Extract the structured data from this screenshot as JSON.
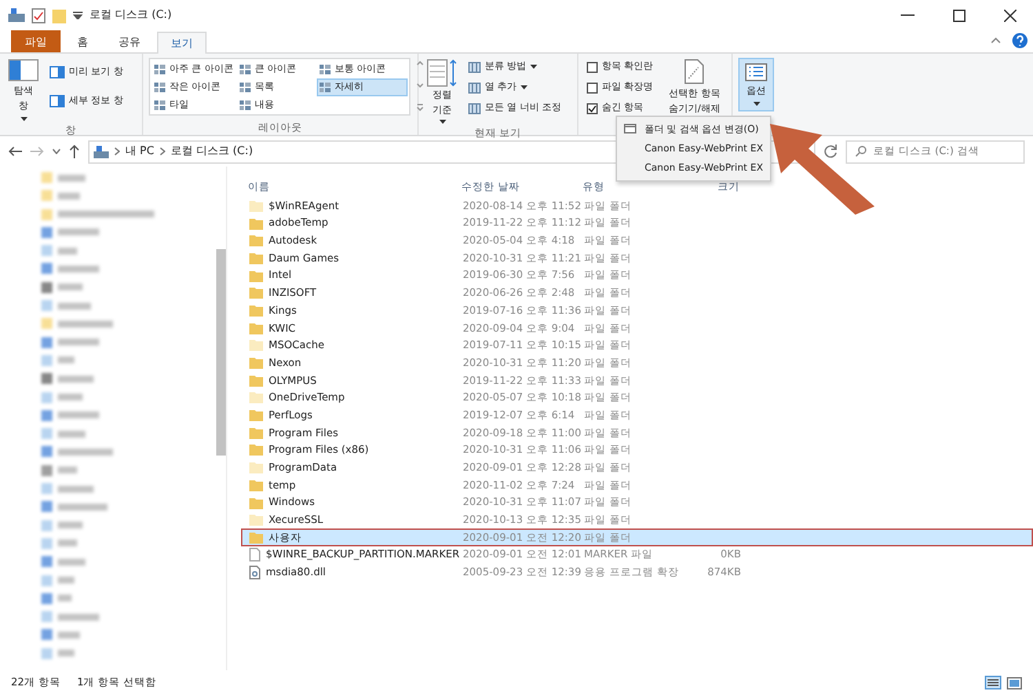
{
  "window": {
    "title": "로컬 디스크 (C:)"
  },
  "ribbon_tabs": [
    {
      "label": "파일",
      "kind": "file",
      "selected": false
    },
    {
      "label": "홈",
      "kind": "tab",
      "selected": false
    },
    {
      "label": "공유",
      "kind": "tab",
      "selected": false
    },
    {
      "label": "보기",
      "kind": "tab",
      "selected": true
    }
  ],
  "pane_group": {
    "label": "창",
    "nav_pane": "탐색 창",
    "preview": "미리 보기 창",
    "details": "세부 정보 창"
  },
  "layout_group": {
    "label": "레이아웃",
    "options": [
      {
        "label": "아주 큰 아이콘",
        "selected": false
      },
      {
        "label": "큰 아이콘",
        "selected": false
      },
      {
        "label": "보통 아이콘",
        "selected": false
      },
      {
        "label": "작은 아이콘",
        "selected": false
      },
      {
        "label": "목록",
        "selected": false
      },
      {
        "label": "자세히",
        "selected": true
      },
      {
        "label": "타일",
        "selected": false
      },
      {
        "label": "내용",
        "selected": false
      }
    ]
  },
  "view_group": {
    "label": "현재 보기",
    "sort": "정렬 기준",
    "group_by": "분류 방법",
    "add_column": "열 추가",
    "fit_columns": "모든 열 너비 조정"
  },
  "show_hide": {
    "checkboxes": [
      {
        "label": "항목 확인란",
        "checked": false
      },
      {
        "label": "파일 확장명",
        "checked": false
      },
      {
        "label": "숨긴 항목",
        "checked": true
      }
    ],
    "hide_selected": "선택한 항목 숨기기/해제"
  },
  "options_button": {
    "label": "옵션",
    "pressed": true
  },
  "options_menu": [
    "폴더 및 검색 옵션 변경(O)",
    "Canon Easy-WebPrint EX",
    "Canon Easy-WebPrint EX"
  ],
  "address": {
    "crumbs": [
      "내 PC",
      "로컬 디스크 (C:)"
    ],
    "search_placeholder": "로컬 디스크 (C:) 검색"
  },
  "columns": [
    "이름",
    "수정한 날짜",
    "유형",
    "크기"
  ],
  "rows": [
    {
      "name": "$WinREAgent",
      "date": "2020-08-14 오후 11:52",
      "type": "파일 폴더",
      "size": "",
      "kind": "folder",
      "hidden": true,
      "selected": false
    },
    {
      "name": "adobeTemp",
      "date": "2019-11-22 오후 11:12",
      "type": "파일 폴더",
      "size": "",
      "kind": "folder",
      "hidden": false,
      "selected": false
    },
    {
      "name": "Autodesk",
      "date": "2020-05-04 오후 4:18",
      "type": "파일 폴더",
      "size": "",
      "kind": "folder",
      "hidden": false,
      "selected": false
    },
    {
      "name": "Daum Games",
      "date": "2020-10-31 오후 11:21",
      "type": "파일 폴더",
      "size": "",
      "kind": "folder",
      "hidden": false,
      "selected": false
    },
    {
      "name": "Intel",
      "date": "2019-06-30 오후 7:56",
      "type": "파일 폴더",
      "size": "",
      "kind": "folder",
      "hidden": false,
      "selected": false
    },
    {
      "name": "INZISOFT",
      "date": "2020-06-26 오후 2:48",
      "type": "파일 폴더",
      "size": "",
      "kind": "folder",
      "hidden": false,
      "selected": false
    },
    {
      "name": "Kings",
      "date": "2019-07-16 오후 11:36",
      "type": "파일 폴더",
      "size": "",
      "kind": "folder",
      "hidden": false,
      "selected": false
    },
    {
      "name": "KWIC",
      "date": "2020-09-04 오후 9:04",
      "type": "파일 폴더",
      "size": "",
      "kind": "folder",
      "hidden": false,
      "selected": false
    },
    {
      "name": "MSOCache",
      "date": "2019-07-11 오후 10:15",
      "type": "파일 폴더",
      "size": "",
      "kind": "folder",
      "hidden": true,
      "selected": false
    },
    {
      "name": "Nexon",
      "date": "2020-10-31 오후 11:20",
      "type": "파일 폴더",
      "size": "",
      "kind": "folder",
      "hidden": false,
      "selected": false
    },
    {
      "name": "OLYMPUS",
      "date": "2019-11-22 오후 11:33",
      "type": "파일 폴더",
      "size": "",
      "kind": "folder",
      "hidden": false,
      "selected": false
    },
    {
      "name": "OneDriveTemp",
      "date": "2020-05-07 오후 10:18",
      "type": "파일 폴더",
      "size": "",
      "kind": "folder",
      "hidden": true,
      "selected": false
    },
    {
      "name": "PerfLogs",
      "date": "2019-12-07 오후 6:14",
      "type": "파일 폴더",
      "size": "",
      "kind": "folder",
      "hidden": false,
      "selected": false
    },
    {
      "name": "Program Files",
      "date": "2020-09-18 오후 11:00",
      "type": "파일 폴더",
      "size": "",
      "kind": "folder",
      "hidden": false,
      "selected": false
    },
    {
      "name": "Program Files (x86)",
      "date": "2020-10-31 오후 11:06",
      "type": "파일 폴더",
      "size": "",
      "kind": "folder",
      "hidden": false,
      "selected": false
    },
    {
      "name": "ProgramData",
      "date": "2020-09-01 오후 12:28",
      "type": "파일 폴더",
      "size": "",
      "kind": "folder",
      "hidden": true,
      "selected": false
    },
    {
      "name": "temp",
      "date": "2020-11-02 오후 7:24",
      "type": "파일 폴더",
      "size": "",
      "kind": "folder",
      "hidden": false,
      "selected": false
    },
    {
      "name": "Windows",
      "date": "2020-10-31 오후 11:07",
      "type": "파일 폴더",
      "size": "",
      "kind": "folder",
      "hidden": false,
      "selected": false
    },
    {
      "name": "XecureSSL",
      "date": "2020-10-13 오후 12:35",
      "type": "파일 폴더",
      "size": "",
      "kind": "folder",
      "hidden": true,
      "selected": false
    },
    {
      "name": "사용자",
      "date": "2020-09-01 오전 12:20",
      "type": "파일 폴더",
      "size": "",
      "kind": "folder",
      "hidden": false,
      "selected": true
    },
    {
      "name": "$WINRE_BACKUP_PARTITION.MARKER",
      "date": "2020-09-01 오전 12:01",
      "type": "MARKER 파일",
      "size": "0KB",
      "kind": "file",
      "hidden": false,
      "selected": false
    },
    {
      "name": "msdia80.dll",
      "date": "2005-09-23 오전 12:39",
      "type": "응용 프로그램 확장",
      "size": "874KB",
      "kind": "dll",
      "hidden": false,
      "selected": false
    }
  ],
  "status_bar": {
    "count": "22개 항목",
    "selection": "1개 항목 선택함"
  }
}
